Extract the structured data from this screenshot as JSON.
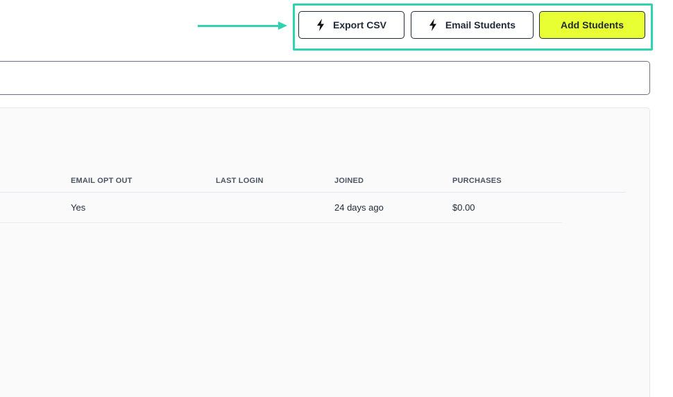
{
  "toolbar": {
    "export_label": "Export CSV",
    "email_label": "Email Students",
    "add_label": "Add Students"
  },
  "search": {
    "value": "",
    "placeholder": ""
  },
  "table": {
    "columns": [
      "EMAIL OPT OUT",
      "LAST LOGIN",
      "JOINED",
      "PURCHASES"
    ],
    "rows": [
      {
        "email_opt_out": "Yes",
        "last_login": "",
        "joined": "24 days ago",
        "purchases": "$0.00"
      }
    ]
  },
  "colors": {
    "accent_add_button": "#e8ff34",
    "annotation": "#2fd3b0"
  },
  "icons": {
    "export": "lightning-bolt-icon",
    "email": "lightning-bolt-icon",
    "annotation_arrow": "arrow-right-icon"
  }
}
